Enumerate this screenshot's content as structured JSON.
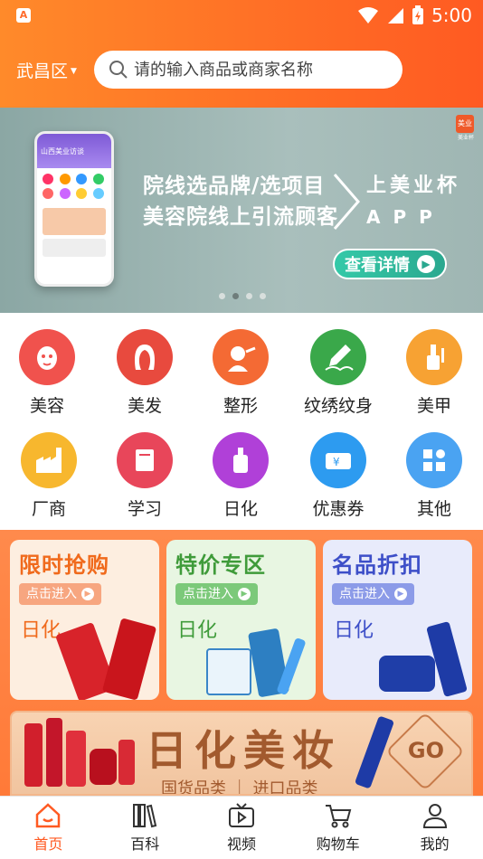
{
  "status_bar": {
    "time": "5:00"
  },
  "location": {
    "district": "武昌区"
  },
  "search": {
    "placeholder": "请的输入商品或商家名称"
  },
  "banner": {
    "line1": "院线选品牌/选项目",
    "line2": "美容院线上引流顾客",
    "brand_line1": "上美业杯",
    "brand_line2": "APP",
    "button_label": "查看详情",
    "logo_text": "美业",
    "logo_caption": "美业杯",
    "phone_title": "山西美业访谈"
  },
  "categories": [
    {
      "label": "美容",
      "color": "#f0524d",
      "icon": "face-mask-icon"
    },
    {
      "label": "美发",
      "color": "#e84a3e",
      "icon": "hair-icon"
    },
    {
      "label": "整形",
      "color": "#f46a34",
      "icon": "plastic-surgery-icon"
    },
    {
      "label": "纹绣纹身",
      "color": "#3aa84a",
      "icon": "pen-nib-icon"
    },
    {
      "label": "美甲",
      "color": "#f7a233",
      "icon": "nail-polish-icon"
    },
    {
      "label": "厂商",
      "color": "#f7b72e",
      "icon": "factory-icon"
    },
    {
      "label": "学习",
      "color": "#e8465a",
      "icon": "book-icon"
    },
    {
      "label": "日化",
      "color": "#b040d8",
      "icon": "bottle-icon"
    },
    {
      "label": "优惠券",
      "color": "#2d9bf0",
      "icon": "coupon-icon"
    },
    {
      "label": "其他",
      "color": "#4aa3f2",
      "icon": "grid-icon"
    }
  ],
  "promo_cards": [
    {
      "title": "限时抢购",
      "enter": "点击进入",
      "sub": "日化",
      "bg": "#fdeee0",
      "title_color": "#f06a1c",
      "pill_color": "#f7a680"
    },
    {
      "title": "特价专区",
      "enter": "点击进入",
      "sub": "日化",
      "bg": "#e8f6e2",
      "title_color": "#3f9b3a",
      "pill_color": "#7cc97a"
    },
    {
      "title": "名品折扣",
      "enter": "点击进入",
      "sub": "日化",
      "bg": "#e8ebfb",
      "title_color": "#3d4fc8",
      "pill_color": "#8c9be8"
    }
  ],
  "big_banner": {
    "title": "日化美妆",
    "subtitle": "国货品类 ｜ 进口品类",
    "go": "GO"
  },
  "tabs": [
    {
      "label": "首页",
      "icon": "home-icon",
      "active": true
    },
    {
      "label": "百科",
      "icon": "books-icon",
      "active": false
    },
    {
      "label": "视频",
      "icon": "tv-icon",
      "active": false
    },
    {
      "label": "购物车",
      "icon": "cart-icon",
      "active": false
    },
    {
      "label": "我的",
      "icon": "user-icon",
      "active": false
    }
  ]
}
